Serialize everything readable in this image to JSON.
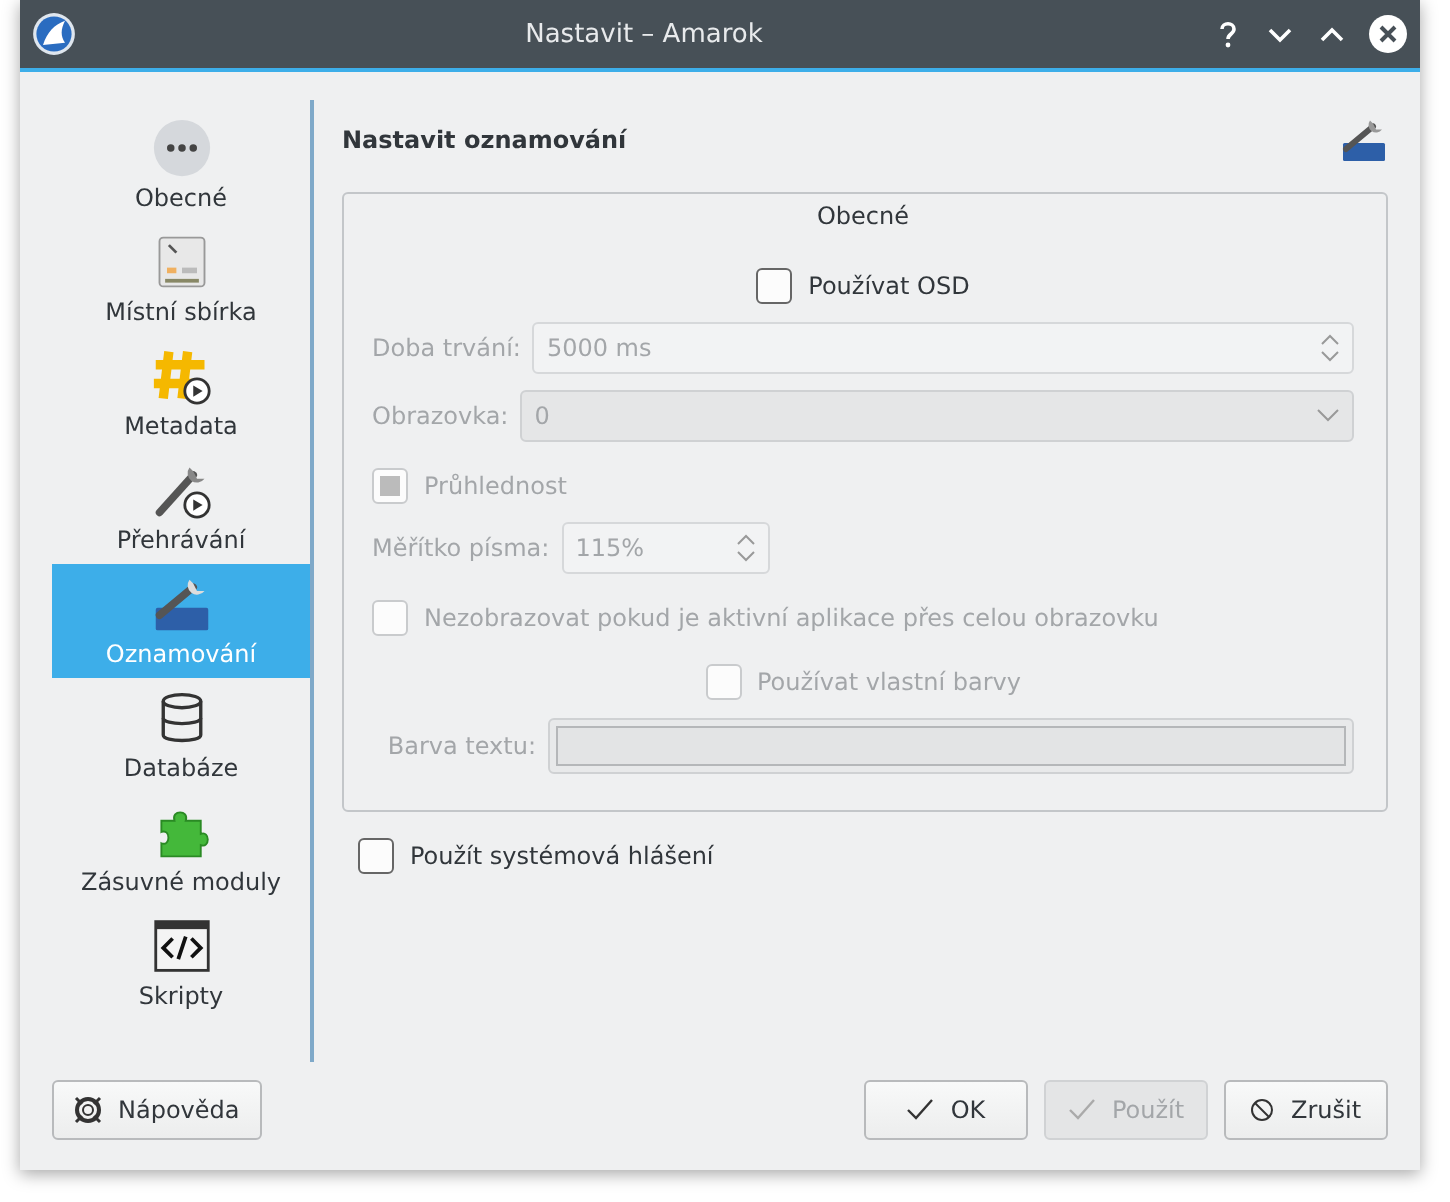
{
  "window": {
    "title": "Nastavit – Amarok"
  },
  "sidebar": {
    "items": [
      {
        "label": "Obecné",
        "selected": false
      },
      {
        "label": "Místní sbírka",
        "selected": false
      },
      {
        "label": "Metadata",
        "selected": false
      },
      {
        "label": "Přehrávání",
        "selected": false
      },
      {
        "label": "Oznamování",
        "selected": true
      },
      {
        "label": "Databáze",
        "selected": false
      },
      {
        "label": "Zásuvné moduly",
        "selected": false
      },
      {
        "label": "Skripty",
        "selected": false
      }
    ]
  },
  "page": {
    "title": "Nastavit oznamování",
    "group": {
      "title": "Obecné",
      "rows": [
        {
          "kind": "check-center",
          "label": "Používat OSD",
          "checked": false,
          "disabled": false
        },
        {
          "kind": "spin",
          "label": "Doba trvání:",
          "value": "5000 ms",
          "disabled": true
        },
        {
          "kind": "combo",
          "label": "Obrazovka:",
          "value": "0",
          "disabled": true
        },
        {
          "kind": "check",
          "label": "Průhlednost",
          "checked": true,
          "disabled": true
        },
        {
          "kind": "spin-small",
          "label": "Měřítko písma:",
          "value": "115%",
          "disabled": true
        },
        {
          "kind": "check",
          "label": "Nezobrazovat pokud je aktivní aplikace přes celou obrazovku",
          "checked": false,
          "disabled": true
        },
        {
          "kind": "check-center",
          "label": "Používat vlastní barvy",
          "checked": false,
          "disabled": true
        },
        {
          "kind": "color",
          "label": "Barva textu:",
          "disabled": true
        }
      ]
    },
    "system": {
      "label": "Použít systémová hlášení",
      "checked": false
    }
  },
  "buttons": {
    "help": {
      "label": "Nápověda"
    },
    "actions": [
      {
        "kind": "ok",
        "label": "OK",
        "disabled": false
      },
      {
        "kind": "apply",
        "label": "Použít",
        "disabled": true
      },
      {
        "kind": "cancel",
        "label": "Zrušit",
        "disabled": false
      }
    ]
  }
}
